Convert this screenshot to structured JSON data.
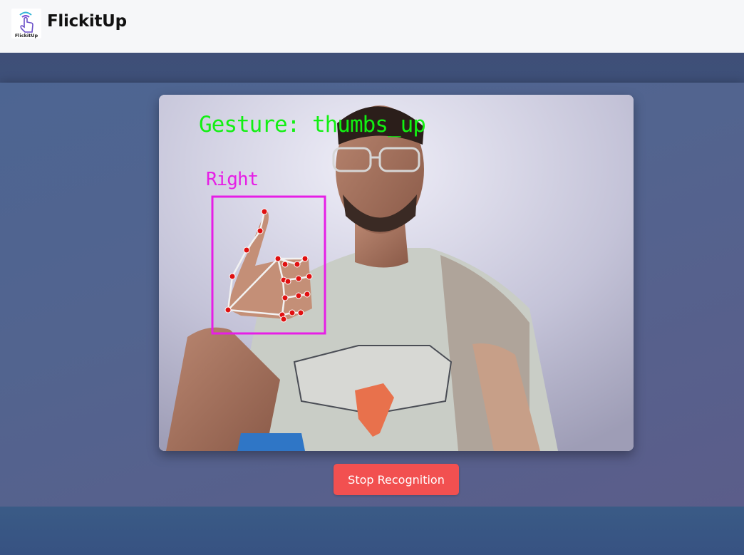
{
  "app": {
    "title": "FlickitUp",
    "logo_text": "FlickitUp"
  },
  "icons": {
    "logo": "hand-tap-icon"
  },
  "video": {
    "gesture_overlay": "Gesture: thumbs_up",
    "hand_label": "Right"
  },
  "controls": {
    "stop_label": "Stop Recognition"
  },
  "colors": {
    "navbar_bg": "#f6f7f9",
    "page_bg": "#3b4f78",
    "button_bg": "#f25050",
    "gesture_text": "#12f012",
    "hand_box": "#e61ee6",
    "landmark": "#e01010"
  }
}
